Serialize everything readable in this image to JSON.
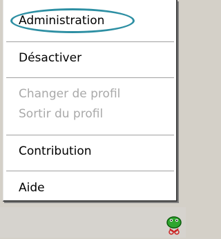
{
  "menu": {
    "items": [
      {
        "label": "Administration",
        "enabled": true,
        "highlighted": true
      },
      {
        "label": "Désactiver",
        "enabled": true
      },
      {
        "label": "Changer de profil",
        "enabled": false
      },
      {
        "label": "Sortir du profil",
        "enabled": false
      },
      {
        "label": "Contribution",
        "enabled": true
      },
      {
        "label": "Aide",
        "enabled": true
      }
    ]
  },
  "colors": {
    "menu_background": "#ffffff",
    "disabled_text": "#a9a9a9",
    "highlight_ring": "#2d8fa3",
    "taskbar": "#d6d3ce"
  },
  "tray": {
    "icon": "green-frog-icon"
  }
}
